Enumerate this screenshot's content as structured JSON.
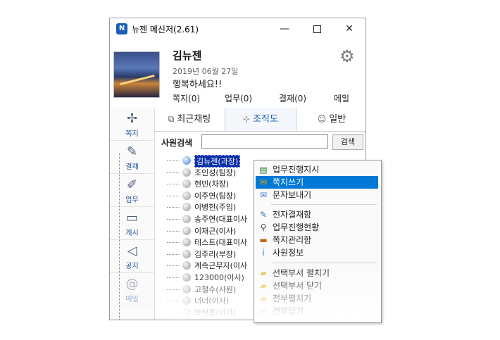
{
  "window": {
    "title": "뉴젠 메신저(2.61)",
    "logo_text": "N",
    "min_glyph": "—",
    "close_glyph": "✕"
  },
  "profile": {
    "name": "김뉴젠",
    "date": "2019년  06월  27일",
    "status": "행복하세요!!",
    "counts": {
      "jjokji": "쪽지(0)",
      "work": "업무(0)",
      "approval": "결재(0)",
      "mail": "메일"
    },
    "gear_glyph": "⚙"
  },
  "sidebar": {
    "items": [
      {
        "label": "쪽지",
        "icon": "✢"
      },
      {
        "label": "결재",
        "icon": "✎"
      },
      {
        "label": "업무",
        "icon": "✐"
      },
      {
        "label": "게시",
        "icon": "▭"
      },
      {
        "label": "공지",
        "icon": "◁"
      },
      {
        "label": "메일",
        "icon": "@"
      }
    ]
  },
  "tabs": [
    {
      "label": "최근채팅",
      "icon": "⧉"
    },
    {
      "label": "조직도",
      "icon": "⊹"
    },
    {
      "label": "일반",
      "icon": "☺"
    }
  ],
  "search": {
    "label": "사원검색",
    "value": "",
    "button": "검색"
  },
  "tree": [
    {
      "label": "김뉴젠(과장)",
      "selected": true,
      "online": true
    },
    {
      "label": "조인성(팀장)",
      "selected": false,
      "online": false
    },
    {
      "label": "현빈(차장)",
      "selected": false,
      "online": false
    },
    {
      "label": "이주연(팀장)",
      "selected": false,
      "online": false
    },
    {
      "label": "이병헌(주임)",
      "selected": false,
      "online": false
    },
    {
      "label": "송주연(대표이사",
      "selected": false,
      "online": false
    },
    {
      "label": "이재근(이사)",
      "selected": false,
      "online": false
    },
    {
      "label": "테스트(대표이사",
      "selected": false,
      "online": false
    },
    {
      "label": "김주리(부장)",
      "selected": false,
      "online": false
    },
    {
      "label": "계속근무자(이사",
      "selected": false,
      "online": false
    },
    {
      "label": "123000(이사)",
      "selected": false,
      "online": false
    },
    {
      "label": "고철수(사원)",
      "selected": false,
      "online": false
    },
    {
      "label": "너너(이사)",
      "selected": false,
      "online": false
    },
    {
      "label": "박현용(이사)",
      "selected": false,
      "online": false
    }
  ],
  "context_menu": {
    "items": [
      {
        "label": "업무진행지시",
        "icon": "▤",
        "color": "#2e7d32"
      },
      {
        "label": "쪽지쓰기",
        "icon": "✉",
        "color": "#e0a800",
        "highlighted": true
      },
      {
        "label": "문자보내기",
        "icon": "✉",
        "color": "#4a7bd0"
      },
      {
        "label": "전자결재함",
        "icon": "✎",
        "color": "#3c6fb8"
      },
      {
        "label": "업무진행현황",
        "icon": "⚲",
        "color": "#444444"
      },
      {
        "label": "쪽지관리함",
        "icon": "▬",
        "color": "#c06a1a"
      },
      {
        "label": "사원정보",
        "icon": "i",
        "color": "#1e88e5"
      },
      {
        "label": "선택부서 펼치기",
        "icon": "▰",
        "color": "#e8c04a"
      },
      {
        "label": "선택부서 닫기",
        "icon": "▰",
        "color": "#e8c04a"
      },
      {
        "label": "전부펼치기",
        "icon": "▰",
        "color": "#e8c04a"
      },
      {
        "label": "전부닫기",
        "icon": "▰",
        "color": "#e8c04a"
      }
    ]
  },
  "colors": {
    "accent": "#1a5fb4",
    "selection": "#0a2fa8",
    "menu_highlight": "#0078d7"
  }
}
